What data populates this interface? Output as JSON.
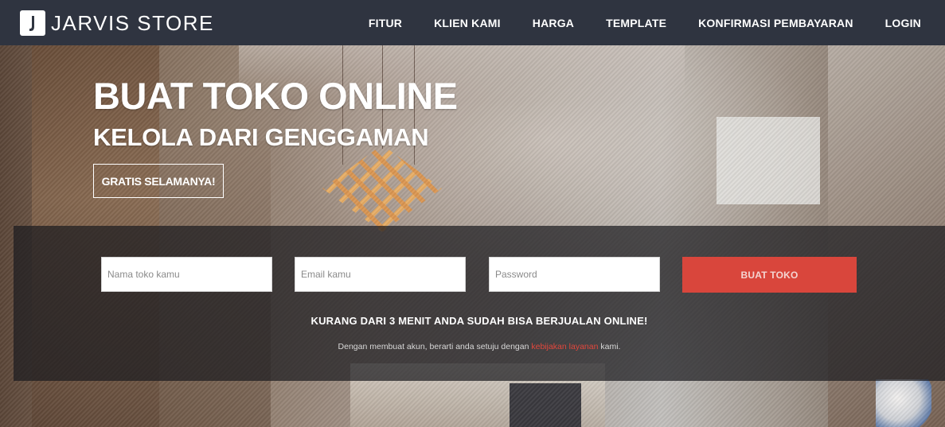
{
  "navbar": {
    "brand": "JARVIS STORE",
    "logo_icon": "bag-logo-icon",
    "items": [
      {
        "label": "FITUR"
      },
      {
        "label": "KLIEN KAMI"
      },
      {
        "label": "HARGA"
      },
      {
        "label": "TEMPLATE"
      },
      {
        "label": "KONFIRMASI PEMBAYARAN"
      },
      {
        "label": "LOGIN"
      }
    ]
  },
  "hero": {
    "headline": "BUAT TOKO ONLINE",
    "subheadline": "KELOLA DARI GENGGAMAN",
    "badge": "GRATIS SELAMANYA!"
  },
  "signup": {
    "store_name_placeholder": "Nama toko kamu",
    "email_placeholder": "Email kamu",
    "password_placeholder": "Password",
    "submit_label": "BUAT TOKO",
    "tagline": "KURANG DARI 3 MENIT ANDA SUDAH BISA BERJUALAN ONLINE!",
    "terms_prefix": "Dengan membuat akun, berarti anda setuju dengan ",
    "terms_link": "kebijakan layanan",
    "terms_suffix": " kami."
  },
  "colors": {
    "navbar_bg": "#2f3440",
    "accent_red": "#d9463c",
    "link_red": "#e2473c"
  }
}
